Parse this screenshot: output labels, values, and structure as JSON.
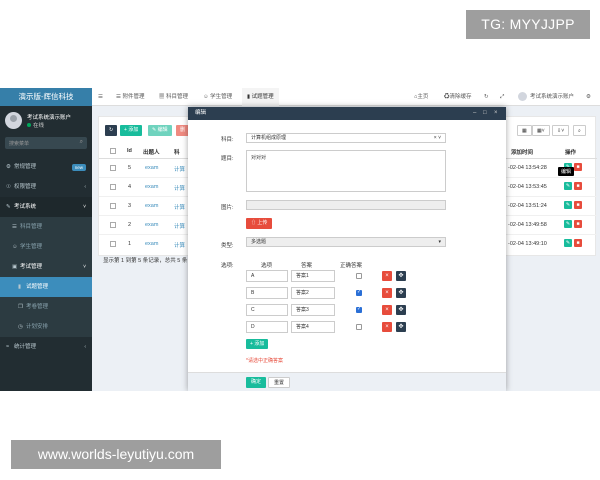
{
  "watermark": {
    "top": "TG: MYYJJPP",
    "bottom": "www.worlds-leyutiyu.com"
  },
  "sidebar": {
    "logo": "演示版-辉信科技",
    "user_name": "考试系统演示账户",
    "user_status": "在线",
    "search_placeholder": "搜索菜单",
    "items": [
      {
        "label": "常规管理",
        "badge": "new"
      },
      {
        "label": "权限管理"
      },
      {
        "label": "考试系统"
      },
      {
        "label": "科目管理"
      },
      {
        "label": "学生管理"
      },
      {
        "label": "考试管理"
      },
      {
        "label": "试题管理"
      },
      {
        "label": "考卷管理"
      },
      {
        "label": "计划安排"
      },
      {
        "label": "统计管理"
      }
    ]
  },
  "topbar": {
    "tabs": [
      "附件管理",
      "科目管理",
      "学生管理",
      "试题管理"
    ],
    "home": "主页",
    "clear_cache": "清除缓存",
    "user": "考试系统演示账户"
  },
  "toolbar": {
    "add": "添加",
    "edit": "编辑",
    "delete": "删"
  },
  "table": {
    "headers": [
      "Id",
      "出题人",
      "科",
      "添加时间",
      "操作"
    ],
    "rows": [
      {
        "id": "5",
        "author": "exam",
        "subject": "计算",
        "time": "-02-04 13:54:28"
      },
      {
        "id": "4",
        "author": "exam",
        "subject": "计算",
        "time": "-02-04 13:53:45"
      },
      {
        "id": "3",
        "author": "exam",
        "subject": "计算",
        "time": "-02-04 13:51:24"
      },
      {
        "id": "2",
        "author": "exam",
        "subject": "计算",
        "time": "-02-04 13:49:58"
      },
      {
        "id": "1",
        "author": "exam",
        "subject": "计算",
        "time": "-02-04 13:49:10"
      }
    ],
    "summary": "显示第 1 到第 5 条记录，总共 5 条",
    "tooltip": "编辑"
  },
  "modal": {
    "title": "编辑",
    "subject_label": "科目:",
    "subject_value": "计算机组成原理",
    "question_label": "题目:",
    "question_value": "对对对",
    "image_label": "图片:",
    "upload_button": "上传",
    "type_label": "类型:",
    "type_value": "多选题",
    "options_label": "选项:",
    "col_option": "选项",
    "col_answer": "答案",
    "col_correct": "正确答案",
    "options": [
      {
        "key": "A",
        "answer": "答案1",
        "correct": false
      },
      {
        "key": "B",
        "answer": "答案2",
        "correct": true
      },
      {
        "key": "C",
        "answer": "答案3",
        "correct": true
      },
      {
        "key": "D",
        "answer": "答案4",
        "correct": false
      }
    ],
    "add_button": "添加",
    "warning": "*请选中正确答案",
    "confirm": "确定",
    "reset": "重置"
  },
  "colors": {
    "sidebar": "#222d32",
    "accent": "#3c8dbc",
    "modal_header": "#2c3e50",
    "success": "#18bc9c",
    "danger": "#e74c3c"
  }
}
